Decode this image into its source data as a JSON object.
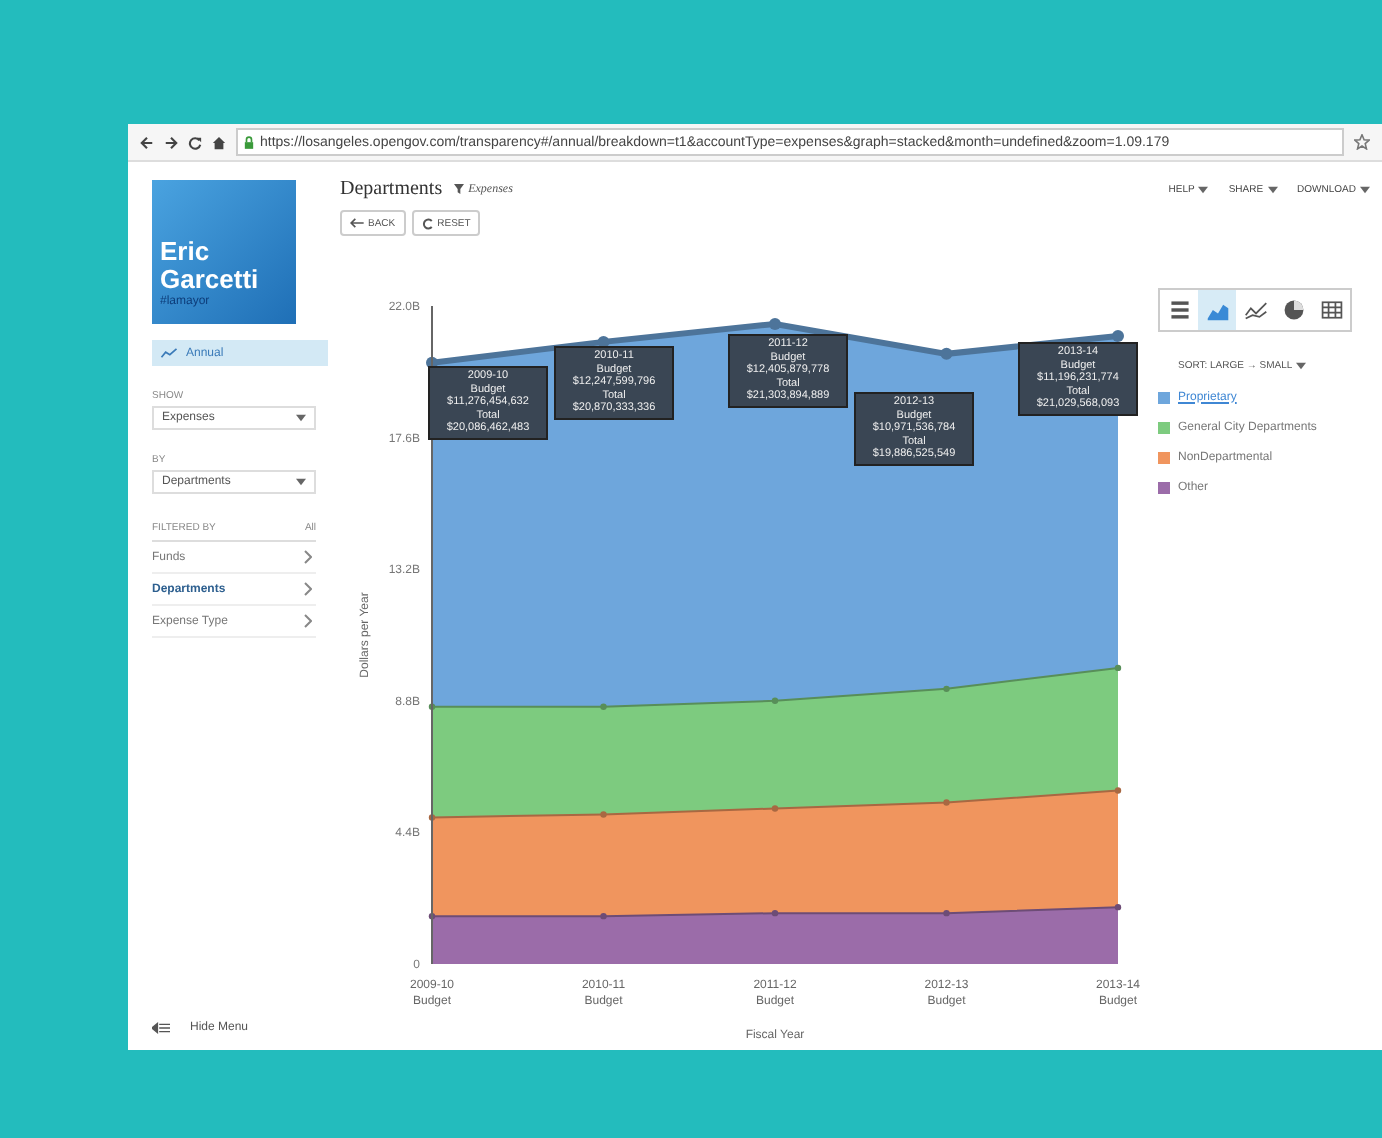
{
  "browser": {
    "url": "https://losangeles.opengov.com/transparency#/annual/breakdown=t1&accountType=expenses&graph=stacked&month=undefined&zoom=1.09.179"
  },
  "sidebar": {
    "logo": {
      "first": "Eric",
      "last": "Garcetti",
      "tag": "#lamayor"
    },
    "nav": [
      {
        "label": "Annual",
        "selected": true
      }
    ],
    "show": {
      "label": "SHOW",
      "value": "Expenses"
    },
    "by": {
      "label": "BY",
      "value": "Departments"
    },
    "filter": {
      "label": "FILTERED BY",
      "all": "All",
      "items": [
        {
          "label": "Funds",
          "selected": false
        },
        {
          "label": "Departments",
          "selected": true
        },
        {
          "label": "Expense Type",
          "selected": false
        }
      ]
    },
    "hide_menu": "Hide Menu"
  },
  "header": {
    "title": "Departments",
    "filter": "Expenses",
    "menus": [
      "HELP",
      "SHARE",
      "DOWNLOAD"
    ],
    "buttons": [
      {
        "label": "BACK",
        "kind": "back"
      },
      {
        "label": "RESET",
        "kind": "reset"
      }
    ]
  },
  "chart_panel": {
    "chart_data": {
      "type": "area",
      "stacked": true,
      "xlabel": "Fiscal Year",
      "ylabel": "Dollars per Year",
      "categories": [
        "2009-10 Budget",
        "2010-11 Budget",
        "2011-12 Budget",
        "2012-13 Budget",
        "2013-14 Budget"
      ],
      "ylim": [
        0,
        22
      ],
      "yticks": [
        {
          "value": 0,
          "label": "0"
        },
        {
          "value": 4.4,
          "label": "4.4B"
        },
        {
          "value": 8.8,
          "label": "8.8B"
        },
        {
          "value": 13.2,
          "label": "13.2B"
        },
        {
          "value": 17.6,
          "label": "17.6B"
        },
        {
          "value": 22,
          "label": "22.0B"
        }
      ],
      "series": [
        {
          "name": "Proprietary",
          "color": "#6ea6dc",
          "values": [
            11.5,
            12.2,
            12.6,
            11.2,
            11.1
          ]
        },
        {
          "name": "General City Departments",
          "color": "#7dcb7f",
          "values": [
            3.7,
            3.6,
            3.6,
            3.8,
            4.1
          ]
        },
        {
          "name": "NonDepartmental",
          "color": "#f0955e",
          "values": [
            3.3,
            3.4,
            3.5,
            3.7,
            3.9
          ]
        },
        {
          "name": "Other",
          "color": "#9b6ca9",
          "values": [
            1.6,
            1.6,
            1.7,
            1.7,
            1.9
          ]
        }
      ]
    },
    "tooltips": [
      {
        "period": "2009-10",
        "label": "Budget",
        "amount": "$11,276,454,632",
        "total_label": "Total",
        "total": "$20,086,462,483"
      },
      {
        "period": "2010-11",
        "label": "Budget",
        "amount": "$12,247,599,796",
        "total_label": "Total",
        "total": "$20,870,333,336"
      },
      {
        "period": "2011-12",
        "label": "Budget",
        "amount": "$12,405,879,778",
        "total_label": "Total",
        "total": "$21,303,894,889"
      },
      {
        "period": "2012-13",
        "label": "Budget",
        "amount": "$10,971,536,784",
        "total_label": "Total",
        "total": "$19,886,525,549"
      },
      {
        "period": "2013-14",
        "label": "Budget",
        "amount": "$11,196,231,774",
        "total_label": "Total",
        "total": "$21,029,568,093"
      }
    ]
  },
  "legend_panel": {
    "views": [
      {
        "kind": "list",
        "selected": false
      },
      {
        "kind": "area",
        "selected": true
      },
      {
        "kind": "line",
        "selected": false
      },
      {
        "kind": "pie",
        "selected": false
      },
      {
        "kind": "table",
        "selected": false
      }
    ],
    "sort": "SORT: LARGE → SMALL",
    "items": [
      {
        "selected": true
      },
      {
        "selected": false
      },
      {
        "selected": false
      },
      {
        "selected": false
      }
    ]
  }
}
